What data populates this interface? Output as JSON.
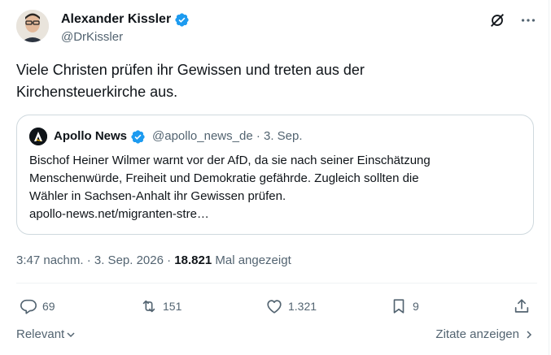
{
  "author": {
    "name": "Alexander Kissler",
    "handle": "@DrKissler"
  },
  "tweet": {
    "text_lines": [
      "Viele Christen prüfen ihr Gewissen und treten aus der",
      "Kirchensteuerkirche aus."
    ]
  },
  "quote": {
    "name": "Apollo News",
    "handle": "@apollo_news_de · 3. Sep.",
    "lines": [
      "Bischof Heiner Wilmer warnt vor der AfD, da sie nach seiner Einschätzung",
      "Menschenwürde, Freiheit und Demokratie gefährde. Zugleich sollten die",
      "Wähler in Sachsen-Anhalt ihr Gewissen prüfen.",
      "apollo-news.net/migranten-stre…"
    ]
  },
  "meta": {
    "time_date": "3:47 nachm. · 3. Sep. 2026 · ",
    "views": "18.821",
    "views_label": " Mal angezeigt"
  },
  "actions": {
    "replies": "69",
    "reposts": "151",
    "likes": "1.321",
    "bookmarks": "9"
  },
  "footer": {
    "sort_label": "Relevant",
    "quotes_link": "Zitate anzeigen"
  },
  "colors": {
    "verified": "#1d9bf0",
    "secondary_text": "#536471",
    "primary_text": "#0f1419",
    "border": "#cfd9de"
  },
  "icons": [
    "verified-badge-icon",
    "grok-icon",
    "more-icon",
    "reply-icon",
    "repost-icon",
    "like-icon",
    "bookmark-icon",
    "share-icon",
    "chevron-down-icon",
    "chevron-right-icon"
  ]
}
